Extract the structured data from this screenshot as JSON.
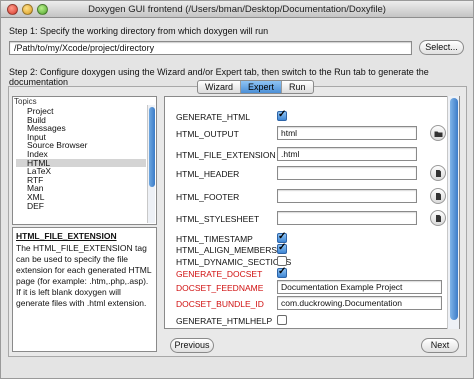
{
  "window": {
    "title": "Doxygen GUI frontend (/Users/bman/Desktop/Documentation/Doxyfile)"
  },
  "step1": {
    "label": "Step 1: Specify the working directory from which doxygen will run",
    "path_value": "/Path/to/my/Xcode/project/directory",
    "select_button": "Select..."
  },
  "step2": {
    "label": "Step 2: Configure doxygen using the Wizard and/or Expert tab, then switch to the Run tab to generate the documentation"
  },
  "tabs": [
    {
      "label": "Wizard",
      "active": false
    },
    {
      "label": "Expert",
      "active": true
    },
    {
      "label": "Run",
      "active": false
    }
  ],
  "topics": {
    "header": "Topics",
    "items": [
      "Project",
      "Build",
      "Messages",
      "Input",
      "Source Browser",
      "Index",
      "HTML",
      "LaTeX",
      "RTF",
      "Man",
      "XML",
      "DEF"
    ],
    "selected": "HTML"
  },
  "help": {
    "title": "HTML_FILE_EXTENSION",
    "text": "The HTML_FILE_EXTENSION tag can be used to specify the file extension for each generated HTML page (for example: .htm,.php,.asp). If it is left blank doxygen will generate files with .html extension."
  },
  "settings": [
    {
      "label": "GENERATE_HTML",
      "type": "checkbox",
      "checked": true,
      "red": false
    },
    {
      "label": "HTML_OUTPUT",
      "type": "text",
      "value": "html",
      "icon": "folder-icon",
      "red": false
    },
    {
      "label": "HTML_FILE_EXTENSION",
      "type": "text",
      "value": ".html",
      "red": false
    },
    {
      "label": "HTML_HEADER",
      "type": "text",
      "value": "",
      "icon": "file-icon",
      "red": false
    },
    {
      "label": "HTML_FOOTER",
      "type": "text",
      "value": "",
      "icon": "file-icon",
      "red": false
    },
    {
      "label": "HTML_STYLESHEET",
      "type": "text",
      "value": "",
      "icon": "file-icon",
      "red": false
    },
    {
      "label": "HTML_TIMESTAMP",
      "type": "checkbox",
      "checked": true,
      "red": false
    },
    {
      "label": "HTML_ALIGN_MEMBERS",
      "type": "checkbox",
      "checked": true,
      "red": false
    },
    {
      "label": "HTML_DYNAMIC_SECTIONS",
      "type": "checkbox",
      "checked": false,
      "red": false
    },
    {
      "label": "GENERATE_DOCSET",
      "type": "checkbox",
      "checked": true,
      "red": true
    },
    {
      "label": "DOCSET_FEEDNAME",
      "type": "text",
      "value": "Documentation Example Project",
      "red": true
    },
    {
      "label": "DOCSET_BUNDLE_ID",
      "type": "text",
      "value": "com.duckrowing.Documentation",
      "red": true
    },
    {
      "label": "GENERATE_HTMLHELP",
      "type": "checkbox",
      "checked": false,
      "red": false
    }
  ],
  "nav": {
    "previous": "Previous",
    "next": "Next"
  },
  "colors": {
    "accent": "#3f86d4",
    "modified_label": "#d01010"
  }
}
